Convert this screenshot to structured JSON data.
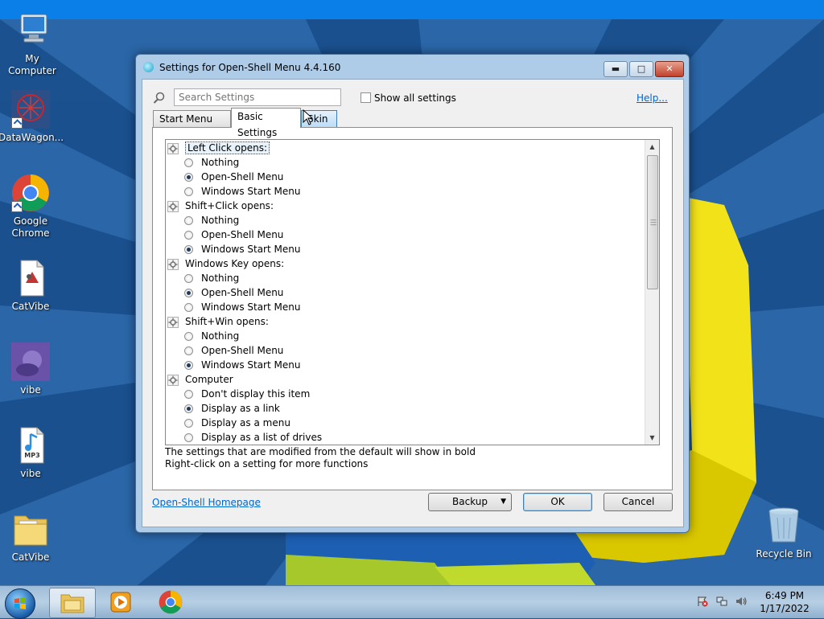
{
  "desktop": {
    "icons": [
      {
        "label": "My Computer"
      },
      {
        "label": "DataWagon..."
      },
      {
        "label": "Google Chrome"
      },
      {
        "label": "CatVibe"
      },
      {
        "label": "vibe"
      },
      {
        "label": "vibe",
        "badge": "MP3"
      },
      {
        "label": "CatVibe"
      },
      {
        "label": "Recycle Bin"
      }
    ]
  },
  "dialog": {
    "title": "Settings for Open-Shell Menu 4.4.160",
    "search_placeholder": "Search Settings",
    "show_all_label": "Show all settings",
    "help_label": "Help...",
    "tabs": [
      {
        "label": "Start Menu Style"
      },
      {
        "label": "Basic Settings"
      },
      {
        "label": "Skin"
      }
    ],
    "tree": [
      {
        "type": "group",
        "label": "Left Click opens:",
        "selected": true
      },
      {
        "type": "option",
        "label": "Nothing",
        "checked": false
      },
      {
        "type": "option",
        "label": "Open-Shell Menu",
        "checked": true
      },
      {
        "type": "option",
        "label": "Windows Start Menu",
        "checked": false
      },
      {
        "type": "group",
        "label": "Shift+Click opens:"
      },
      {
        "type": "option",
        "label": "Nothing",
        "checked": false
      },
      {
        "type": "option",
        "label": "Open-Shell Menu",
        "checked": false
      },
      {
        "type": "option",
        "label": "Windows Start Menu",
        "checked": true
      },
      {
        "type": "group",
        "label": "Windows Key opens:"
      },
      {
        "type": "option",
        "label": "Nothing",
        "checked": false
      },
      {
        "type": "option",
        "label": "Open-Shell Menu",
        "checked": true
      },
      {
        "type": "option",
        "label": "Windows Start Menu",
        "checked": false
      },
      {
        "type": "group",
        "label": "Shift+Win opens:"
      },
      {
        "type": "option",
        "label": "Nothing",
        "checked": false
      },
      {
        "type": "option",
        "label": "Open-Shell Menu",
        "checked": false
      },
      {
        "type": "option",
        "label": "Windows Start Menu",
        "checked": true
      },
      {
        "type": "group",
        "label": "Computer"
      },
      {
        "type": "option",
        "label": "Don't display this item",
        "checked": false
      },
      {
        "type": "option",
        "label": "Display as a link",
        "checked": true
      },
      {
        "type": "option",
        "label": "Display as a menu",
        "checked": false
      },
      {
        "type": "option",
        "label": "Display as a list of drives",
        "checked": false
      }
    ],
    "note_line1": "The settings that are modified from the default will show in bold",
    "note_line2": "Right-click on a setting for more functions",
    "homepage_link": "Open-Shell Homepage",
    "backup_label": "Backup",
    "ok_label": "OK",
    "cancel_label": "Cancel"
  },
  "taskbar": {
    "time": "6:49 PM",
    "date": "1/17/2022"
  },
  "colors": {
    "wallpaper_blue": "#1f5a9a",
    "link": "#0066cc",
    "accent": "#3c7fb1"
  }
}
